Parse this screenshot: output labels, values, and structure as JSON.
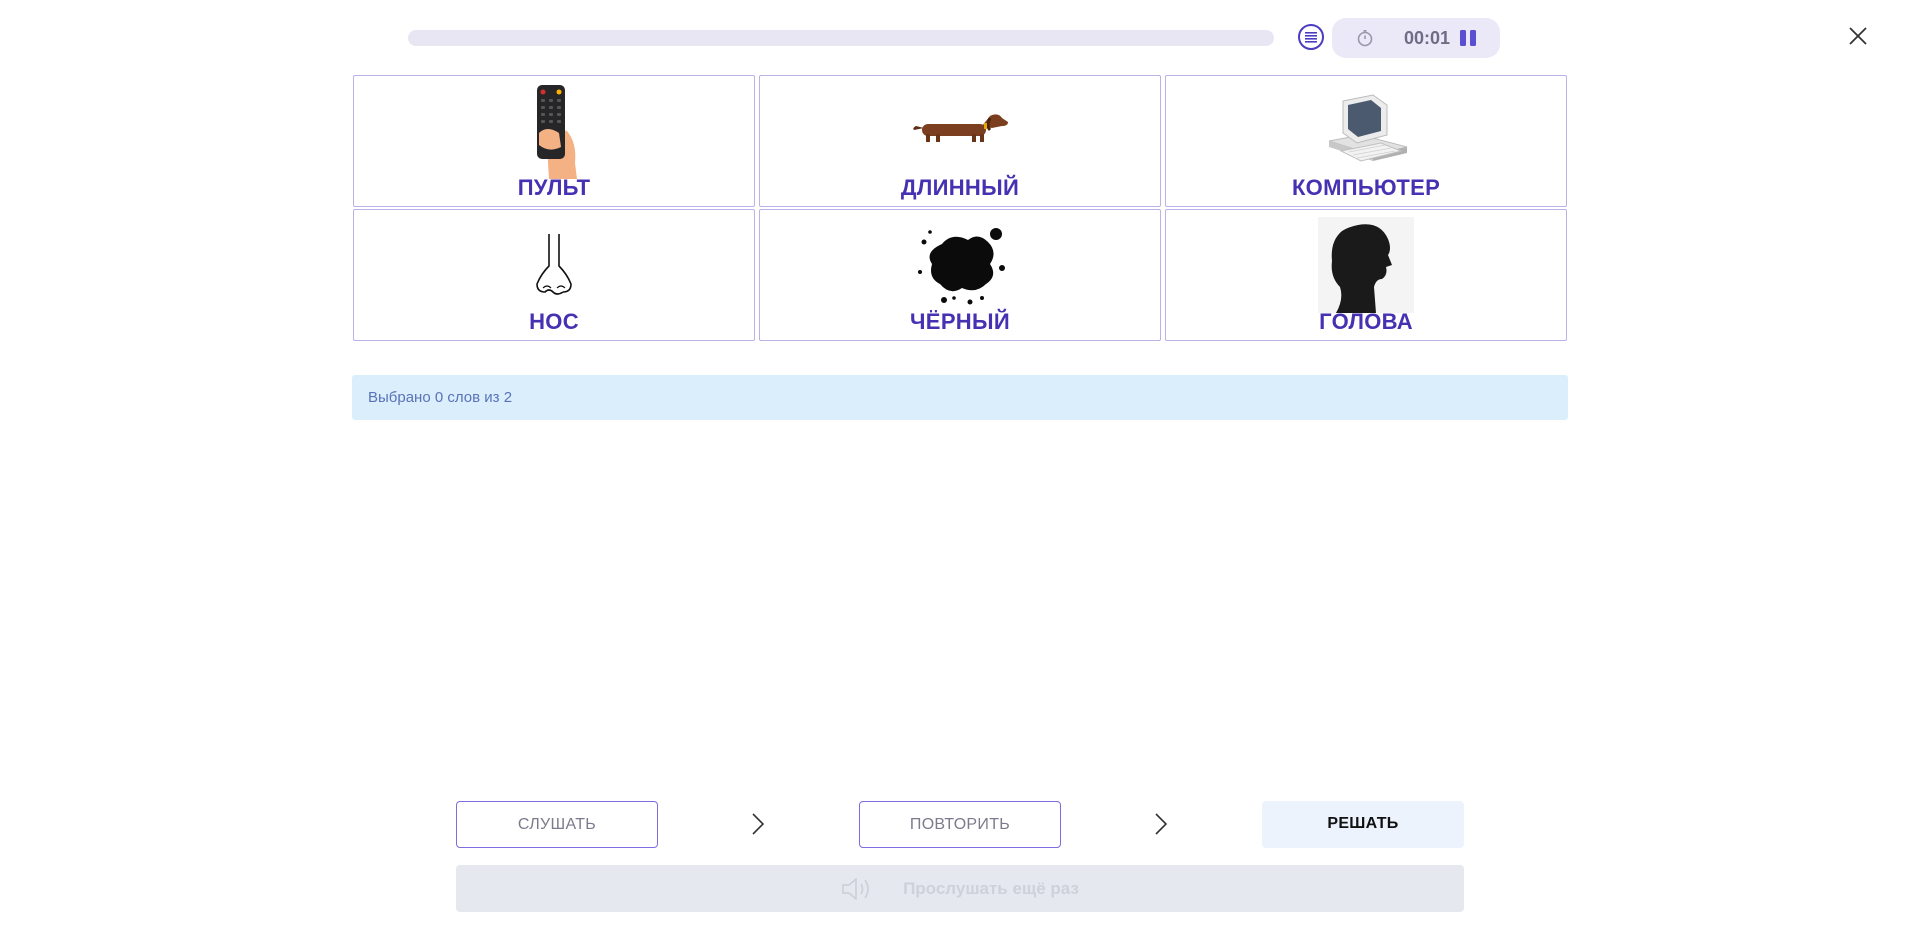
{
  "header": {
    "progress_percent": 0,
    "timer": "00:01",
    "icons": {
      "list": "list-icon",
      "stopwatch": "stopwatch-icon",
      "pause": "pause-icon",
      "close": "close-icon"
    }
  },
  "cards": [
    {
      "word": "ПУЛЬТ",
      "icon": "remote-control-icon"
    },
    {
      "word": "ДЛИННЫЙ",
      "icon": "dachshund-icon"
    },
    {
      "word": "КОМПЬЮТЕР",
      "icon": "computer-icon"
    },
    {
      "word": "НОС",
      "icon": "nose-icon"
    },
    {
      "word": "ЧЁРНЫЙ",
      "icon": "ink-blot-icon"
    },
    {
      "word": "ГОЛОВА",
      "icon": "head-silhouette-icon"
    }
  ],
  "status": {
    "text": "Выбрано 0 слов из 2"
  },
  "steps": {
    "listen_label": "СЛУШАТЬ",
    "repeat_label": "ПОВТОРИТЬ",
    "solve_label": "РЕШАТЬ"
  },
  "replay": {
    "label": "Прослушать ещё раз",
    "icon": "speaker-icon"
  },
  "colors": {
    "accent": "#4631b3",
    "card_border": "#b9b3e6",
    "status_bg": "#dbeefc",
    "status_text": "#5a73b8"
  }
}
